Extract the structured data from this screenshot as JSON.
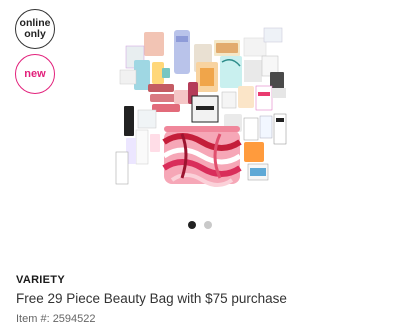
{
  "badges": {
    "online_line1": "online",
    "online_line2": "only",
    "new": "new"
  },
  "product": {
    "brand": "VARIETY",
    "name": "Free 29 Piece Beauty Bag with $75 purchase",
    "item_label": "Item #:",
    "item_number": "2594522",
    "image_icon": "beauty-bag-collection-image"
  },
  "carousel": {
    "total": 2,
    "active_index": 1
  },
  "colors": {
    "new_badge": "#e2207b",
    "active_dot": "#222222",
    "inactive_dot": "#c9c9c9"
  }
}
